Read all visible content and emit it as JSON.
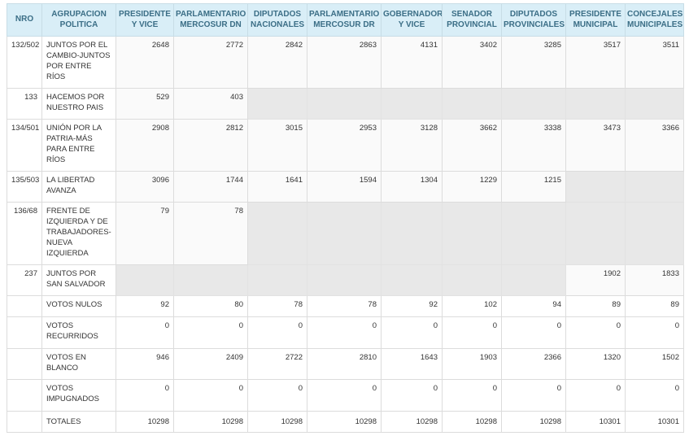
{
  "columns": [
    {
      "key": "nro",
      "label": "NRO"
    },
    {
      "key": "agrupacion",
      "label": "AGRUPACION POLITICA"
    },
    {
      "key": "presidente",
      "label": "PRESIDENTE Y VICE"
    },
    {
      "key": "parl_dn",
      "label": "PARLAMENTARIO MERCOSUR DN"
    },
    {
      "key": "dip_nac",
      "label": "DIPUTADOS NACIONALES"
    },
    {
      "key": "parl_dr",
      "label": "PARLAMENTARIO MERCOSUR DR"
    },
    {
      "key": "gobernador",
      "label": "GOBERNADOR Y VICE"
    },
    {
      "key": "senador",
      "label": "SENADOR PROVINCIAL"
    },
    {
      "key": "dip_prov",
      "label": "DIPUTADOS PROVINCIALES"
    },
    {
      "key": "pres_mun",
      "label": "PRESIDENTE MUNICIPAL"
    },
    {
      "key": "concejales",
      "label": "CONCEJALES MUNICIPALES"
    }
  ],
  "rows": [
    {
      "kind": "party",
      "nro": "132/502",
      "name": "JUNTOS POR EL CAMBIO-JUNTOS POR ENTRE RÍOS",
      "values": [
        "2648",
        "2772",
        "2842",
        "2863",
        "4131",
        "3402",
        "3285",
        "3517",
        "3511"
      ]
    },
    {
      "kind": "party",
      "nro": "133",
      "name": "HACEMOS POR NUESTRO PAIS",
      "values": [
        "529",
        "403",
        null,
        null,
        null,
        null,
        null,
        null,
        null
      ]
    },
    {
      "kind": "party",
      "nro": "134/501",
      "name": "UNIÓN POR LA PATRIA-MÁS PARA ENTRE RÍOS",
      "values": [
        "2908",
        "2812",
        "3015",
        "2953",
        "3128",
        "3662",
        "3338",
        "3473",
        "3366"
      ]
    },
    {
      "kind": "party",
      "nro": "135/503",
      "name": "LA LIBERTAD AVANZA",
      "values": [
        "3096",
        "1744",
        "1641",
        "1594",
        "1304",
        "1229",
        "1215",
        null,
        null
      ]
    },
    {
      "kind": "party",
      "nro": "136/68",
      "name": "FRENTE DE IZQUIERDA Y DE TRABAJADORES-NUEVA IZQUIERDA",
      "values": [
        "79",
        "78",
        null,
        null,
        null,
        null,
        null,
        null,
        null
      ]
    },
    {
      "kind": "party",
      "nro": "237",
      "name": "JUNTOS POR SAN SALVADOR",
      "values": [
        null,
        null,
        null,
        null,
        null,
        null,
        null,
        "1902",
        "1833"
      ]
    },
    {
      "kind": "summary",
      "nro": "",
      "name": "VOTOS NULOS",
      "values": [
        "92",
        "80",
        "78",
        "78",
        "92",
        "102",
        "94",
        "89",
        "89"
      ]
    },
    {
      "kind": "summary",
      "nro": "",
      "name": "VOTOS RECURRIDOS",
      "values": [
        "0",
        "0",
        "0",
        "0",
        "0",
        "0",
        "0",
        "0",
        "0"
      ]
    },
    {
      "kind": "summary",
      "nro": "",
      "name": "VOTOS EN BLANCO",
      "values": [
        "946",
        "2409",
        "2722",
        "2810",
        "1643",
        "1903",
        "2366",
        "1320",
        "1502"
      ]
    },
    {
      "kind": "summary",
      "nro": "",
      "name": "VOTOS IMPUGNADOS",
      "values": [
        "0",
        "0",
        "0",
        "0",
        "0",
        "0",
        "0",
        "0",
        "0"
      ]
    },
    {
      "kind": "total",
      "nro": "",
      "name": "TOTALES",
      "values": [
        "10298",
        "10298",
        "10298",
        "10298",
        "10298",
        "10298",
        "10298",
        "10301",
        "10301"
      ]
    }
  ]
}
